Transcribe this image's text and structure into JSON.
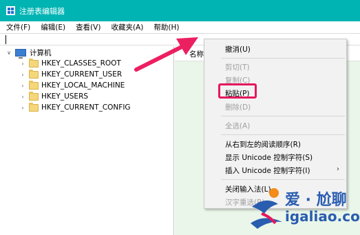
{
  "window": {
    "title": "注册表编辑器"
  },
  "menubar": {
    "items": [
      "文件(F)",
      "编辑(E)",
      "查看(V)",
      "收藏夹(A)",
      "帮助(H)"
    ]
  },
  "tree": {
    "root": "计算机",
    "children": [
      "HKEY_CLASSES_ROOT",
      "HKEY_CURRENT_USER",
      "HKEY_LOCAL_MACHINE",
      "HKEY_USERS",
      "HKEY_CURRENT_CONFIG"
    ]
  },
  "list": {
    "name_header": "名称"
  },
  "context_menu": {
    "undo": "撤消(U)",
    "cut": "剪切(T)",
    "copy": "复制(C)",
    "paste": "粘贴(P)",
    "delete": "删除(D)",
    "select_all": "全选(A)",
    "rtl": "从右到左的阅读顺序(R)",
    "show_unicode": "显示 Unicode 控制字符(S)",
    "insert_unicode": "插入 Unicode 控制字符(I)",
    "close_ime": "关闭输入法(L)",
    "reconvert": "汉字重选(R)"
  },
  "watermark": {
    "brand": "爱 · 尬聊",
    "url": "igaliao.com"
  },
  "colors": {
    "titlebar": "#00b4b4",
    "accent": "#e6175d",
    "pane": "#e9f6e9"
  }
}
